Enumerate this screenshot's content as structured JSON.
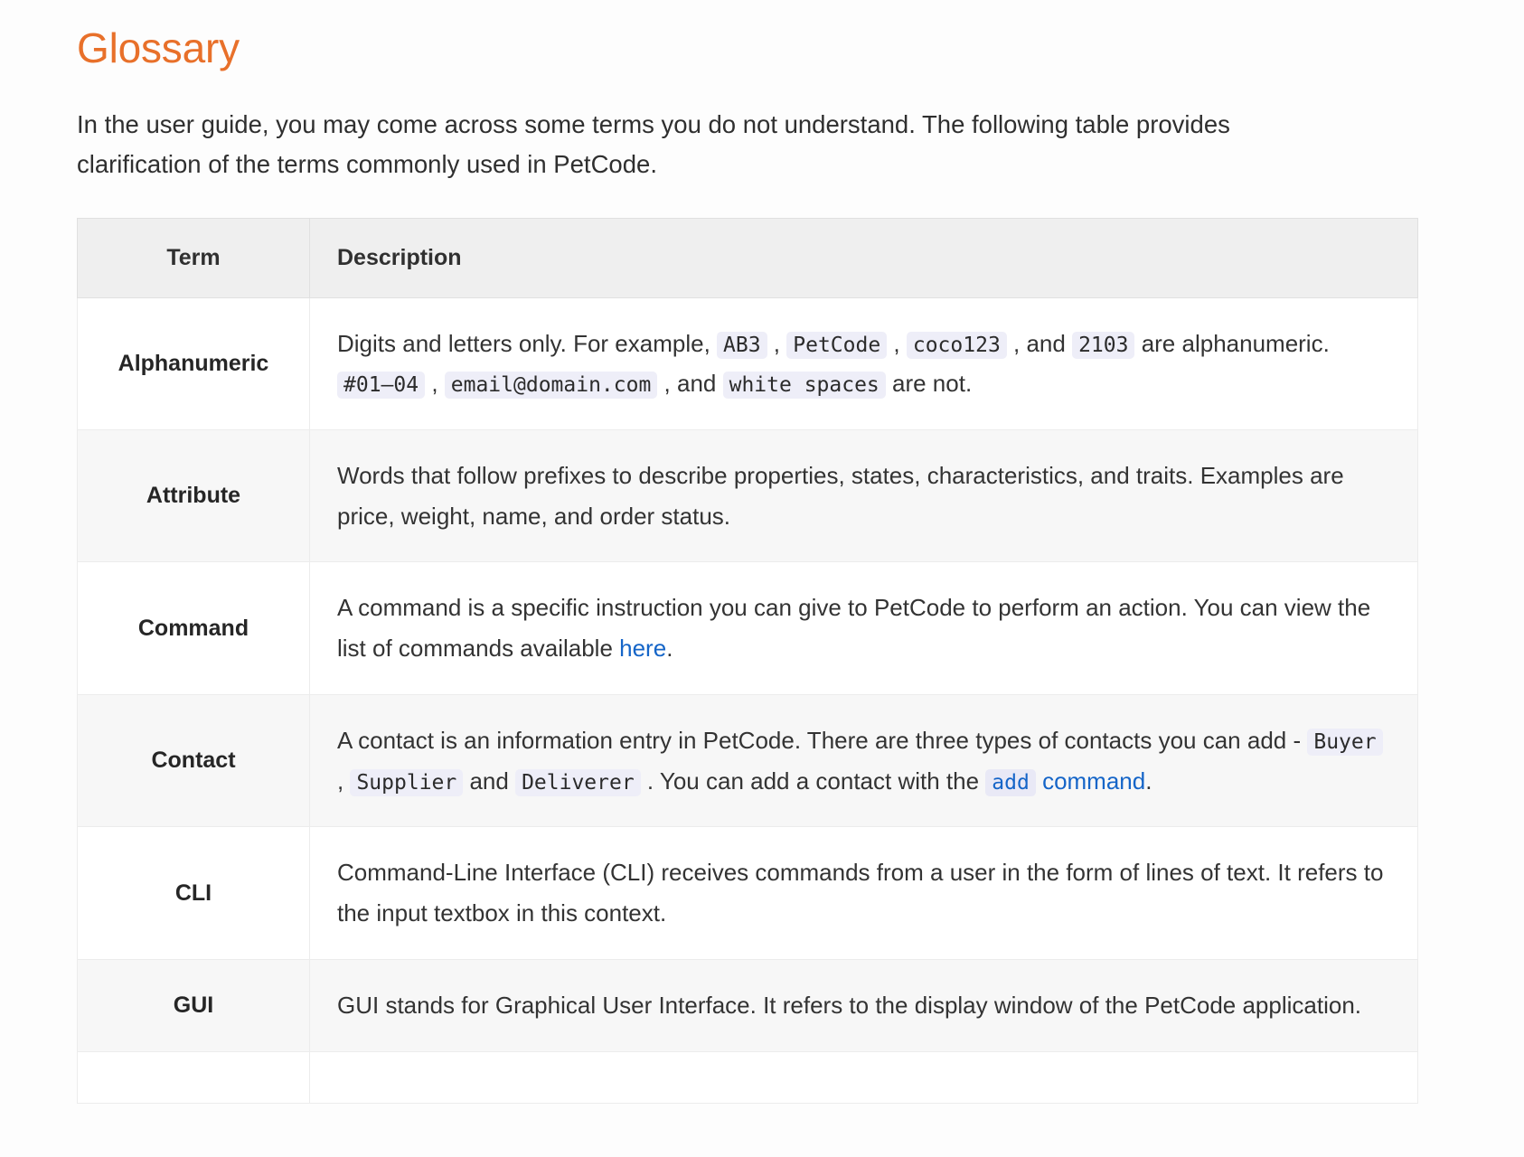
{
  "page": {
    "title": "Glossary",
    "title_color": "#e8702a",
    "intro": "In the user guide, you may come across some terms you do not understand. The following table provides clarification of the terms commonly used in PetCode."
  },
  "table": {
    "columns": [
      "Term",
      "Description"
    ],
    "rows": [
      {
        "term": "Alphanumeric",
        "segments": [
          {
            "type": "text",
            "value": "Digits and letters only. For example, "
          },
          {
            "type": "code",
            "value": "AB3"
          },
          {
            "type": "text",
            "value": " , "
          },
          {
            "type": "code",
            "value": "PetCode"
          },
          {
            "type": "text",
            "value": " , "
          },
          {
            "type": "code",
            "value": "coco123"
          },
          {
            "type": "text",
            "value": " , and "
          },
          {
            "type": "code",
            "value": "2103"
          },
          {
            "type": "text",
            "value": " are alphanumeric. "
          },
          {
            "type": "code",
            "value": "#01–04"
          },
          {
            "type": "text",
            "value": " , "
          },
          {
            "type": "code",
            "value": "email@domain.com"
          },
          {
            "type": "text",
            "value": " , and "
          },
          {
            "type": "code",
            "value": "white spaces"
          },
          {
            "type": "text",
            "value": " are not."
          }
        ]
      },
      {
        "term": "Attribute",
        "segments": [
          {
            "type": "text",
            "value": "Words that follow prefixes to describe properties, states, characteristics, and traits. Examples are price, weight, name, and order status."
          }
        ]
      },
      {
        "term": "Command",
        "segments": [
          {
            "type": "text",
            "value": "A command is a specific instruction you can give to PetCode to perform an action. You can view the list of commands available "
          },
          {
            "type": "link",
            "value": "here"
          },
          {
            "type": "text",
            "value": "."
          }
        ]
      },
      {
        "term": "Contact",
        "segments": [
          {
            "type": "text",
            "value": "A contact is an information entry in PetCode. There are three types of contacts you can add - "
          },
          {
            "type": "code",
            "value": "Buyer"
          },
          {
            "type": "text",
            "value": " , "
          },
          {
            "type": "code",
            "value": "Supplier"
          },
          {
            "type": "text",
            "value": " and "
          },
          {
            "type": "code",
            "value": "Deliverer"
          },
          {
            "type": "text",
            "value": " . You can add a contact with the "
          },
          {
            "type": "link-code",
            "code": "add",
            "value": " command"
          },
          {
            "type": "text",
            "value": "."
          }
        ]
      },
      {
        "term": "CLI",
        "segments": [
          {
            "type": "text",
            "value": "Command-Line Interface (CLI) receives commands from a user in the form of lines of text. It refers to the input textbox in this context."
          }
        ]
      },
      {
        "term": "GUI",
        "segments": [
          {
            "type": "text",
            "value": "GUI stands for Graphical User Interface. It refers to the display window of the PetCode application."
          }
        ]
      },
      {
        "term": "",
        "segments": []
      }
    ]
  }
}
